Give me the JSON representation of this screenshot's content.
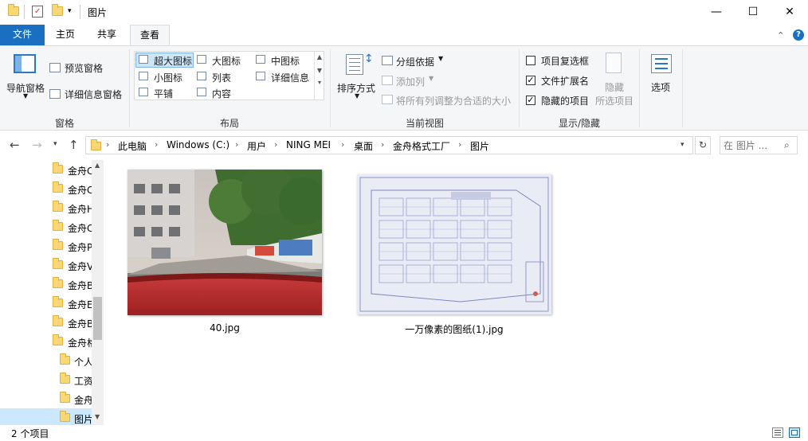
{
  "title_bar": {
    "title": "图片",
    "window_controls": {
      "minimize": "—",
      "maximize": "☐",
      "close": "✕"
    }
  },
  "ribbon_tabs": [
    {
      "label": "文件"
    },
    {
      "label": "主页"
    },
    {
      "label": "共享"
    },
    {
      "label": "查看"
    }
  ],
  "ribbon": {
    "panes": {
      "label": "窗格",
      "nav_pane": "导航窗格",
      "preview_pane": "预览窗格",
      "details_pane": "详细信息窗格"
    },
    "layout": {
      "label": "布局",
      "options": [
        "超大图标",
        "大图标",
        "中图标",
        "小图标",
        "列表",
        "详细信息",
        "平铺",
        "内容"
      ],
      "selected": "超大图标"
    },
    "current_view": {
      "label": "当前视图",
      "sort_by": "排序方式",
      "group_by": "分组依据",
      "add_columns": "添加列",
      "size_all_columns": "将所有列调整为合适的大小"
    },
    "show_hide": {
      "label": "显示/隐藏",
      "item_checkboxes": "项目复选框",
      "file_extensions": "文件扩展名",
      "hidden_items": "隐藏的项目",
      "hide_selected_1": "隐藏",
      "hide_selected_2": "所选项目",
      "item_checkboxes_checked": false,
      "file_extensions_checked": true,
      "hidden_items_checked": true
    },
    "options": "选项"
  },
  "address_bar": {
    "crumbs": [
      "此电脑",
      "Windows (C:)",
      "用户",
      "NING MEI",
      "桌面",
      "金舟格式工厂",
      "图片"
    ],
    "search_placeholder": "在 图片 ..."
  },
  "nav_pane": {
    "items": [
      {
        "label": "金舟C"
      },
      {
        "label": "金舟C"
      },
      {
        "label": "金舟H"
      },
      {
        "label": "金舟C"
      },
      {
        "label": "金舟P"
      },
      {
        "label": "金舟V"
      },
      {
        "label": "金舟B"
      },
      {
        "label": "金舟E"
      },
      {
        "label": "金舟B"
      },
      {
        "label": "金舟格"
      },
      {
        "label": "个人"
      },
      {
        "label": "工资"
      },
      {
        "label": "金舟"
      },
      {
        "label": "图片"
      }
    ]
  },
  "files": [
    {
      "name": "40.jpg"
    },
    {
      "name": "一万像素的图纸(1).jpg"
    }
  ],
  "status_bar": {
    "item_count": "2 个项目"
  }
}
